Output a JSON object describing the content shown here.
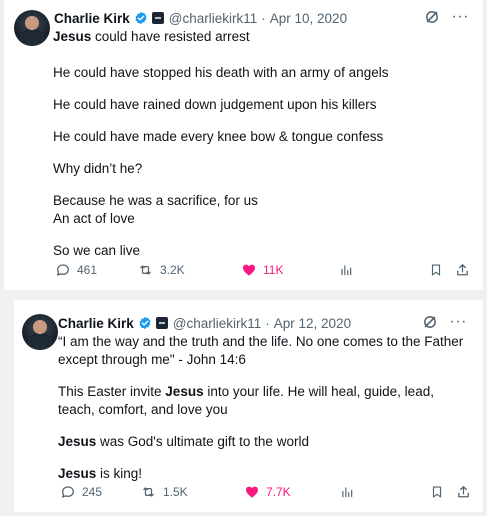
{
  "tweets": [
    {
      "author": {
        "name": "Charlie Kirk",
        "handle": "@charliekirk11"
      },
      "date": "Apr 10, 2020",
      "separator": "·",
      "more": "···",
      "lines": {
        "l1_bold": "Jesus",
        "l1_rest": " could have resisted arrest",
        "l2": "He could have stopped his death with an army of angels",
        "l3": "He could have rained down judgement upon his killers",
        "l4": "He could have made every knee bow & tongue confess",
        "l5": "Why didn’t he?",
        "l6": "Because he was a sacrifice, for us",
        "l7": "An act of love",
        "l8": "So we can live"
      },
      "stats": {
        "replies": "461",
        "retweets": "3.2K",
        "likes": "11K"
      }
    },
    {
      "author": {
        "name": "Charlie Kirk",
        "handle": "@charliekirk11"
      },
      "date": "Apr 12, 2020",
      "separator": "·",
      "more": "···",
      "lines": {
        "p1": "“I am the way and the truth and the life. No one comes to the Father except through me\" - John 14:6",
        "p2_pre": "This Easter invite ",
        "p2_bold": "Jesus",
        "p2_post": " into your life. He will heal, guide, lead, teach, comfort, and love you",
        "p3_bold": "Jesus",
        "p3_rest": " was God's ultimate gift to the world",
        "p4_bold": "Jesus",
        "p4_rest": " is king!"
      },
      "stats": {
        "replies": "245",
        "retweets": "1.5K",
        "likes": "7.7K"
      }
    }
  ],
  "colors": {
    "text": "#0f1419",
    "secondary": "#536471",
    "verified": "#1d9bf0",
    "like": "#f91880",
    "background": "#eef0f2"
  },
  "icons": [
    "verified-badge-icon",
    "affiliate-badge-icon",
    "grok-icon",
    "more-icon",
    "reply-icon",
    "retweet-icon",
    "heart-icon",
    "views-icon",
    "bookmark-icon",
    "share-icon"
  ]
}
